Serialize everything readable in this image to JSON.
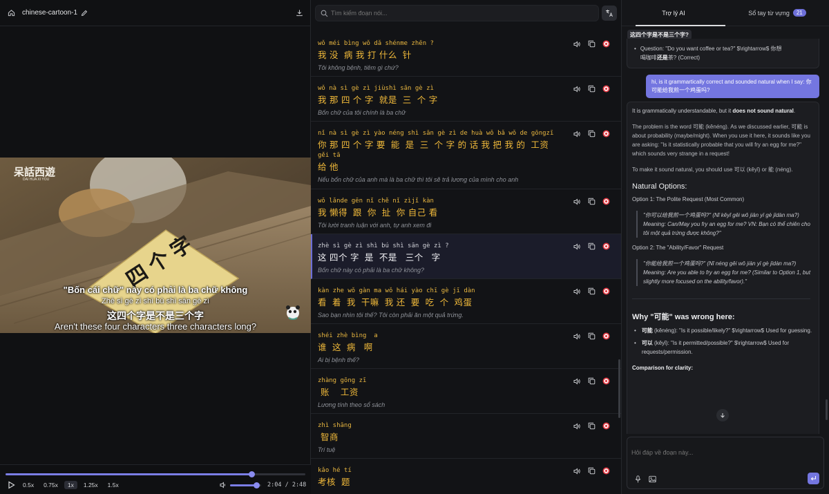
{
  "header": {
    "title": "chinese-cartoon-1"
  },
  "video": {
    "logo": "呆話西遊",
    "logo_sub": "DAI HUA XI YOU",
    "card_text": "四个字",
    "sub_vi": "\"Bốn cái chữ\" này có phải là ba chữ không",
    "sub_pinyin": "Zhè sì gè zì shì bù shì sān gè zì",
    "sub_zh": "这四个字是不是三个字",
    "sub_en": "Aren't these four characters three characters long?",
    "progress": 0.82
  },
  "player": {
    "speeds": [
      "0.5x",
      "0.75x",
      "1x",
      "1.25x",
      "1.5x"
    ],
    "active_speed": "1x",
    "time": "2:04 / 2:48",
    "volume": 0.85
  },
  "search": {
    "placeholder": "Tìm kiếm đoạn nói..."
  },
  "segments": [
    {
      "pinyin": "wǒ méi bìng wǒ dǎ shénme zhēn ?",
      "hanzi": "我 没  病 我 打 什么  针",
      "trans": "Tôi không bệnh, tiêm gì chứ?"
    },
    {
      "pinyin": "wǒ nà sì gè zì jiùshì sān gè zì",
      "hanzi": "我 那 四 个 字  就是  三  个 字",
      "trans": "Bốn chữ của tôi chính là ba chữ"
    },
    {
      "pinyin": "nǐ nà sì gè zì yào néng shì sān gè zì de huà wǒ bǎ wǒ de gōngzī",
      "hanzi": "你 那 四 个 字 要  能  是  三  个 字 的 话 我 把 我 的  工资",
      "pinyin2": "gěi tā",
      "hanzi2": "给 他",
      "trans": "Nếu bốn chữ của anh mà là ba chữ thì tôi sẽ trả lương của mình cho anh"
    },
    {
      "pinyin": "wǒ lǎnde gēn nǐ chě nǐ zìjǐ kàn",
      "hanzi": "我 懒得  跟  你  扯  你 自己 看",
      "trans": "Tôi lười tranh luận với anh, tự anh xem đi"
    },
    {
      "pinyin": "zhè sì gè zì shì bú shì sān gè zì ?",
      "hanzi": "这 四个 字  是  不是   三个   字",
      "trans": "Bốn chữ này có phải là ba chữ không?",
      "active": true
    },
    {
      "pinyin": "kàn zhe wǒ gàn ma wǒ hái yào chī gè jī dàn",
      "hanzi": "看  着  我  干嘛  我 还  要  吃  个  鸡蛋",
      "trans": "Sao bạn nhìn tôi thế? Tôi còn phải ăn một quả trứng."
    },
    {
      "pinyin": "shéi zhè bìng  a",
      "hanzi": "谁  这  病   啊",
      "trans": "Ai bị bệnh thế?"
    },
    {
      "pinyin": "zhàng gōng zī",
      "hanzi": " 账    工资",
      "trans": "Lương tính theo sổ sách"
    },
    {
      "pinyin": "zhì shāng",
      "hanzi": " 智商",
      "trans": "Trí tuệ"
    },
    {
      "pinyin": "kǎo hé tí",
      "hanzi": "考核  题",
      "trans": ""
    }
  ],
  "tabs": {
    "ai": "Trợ lý AI",
    "vocab": "Sổ tay từ vựng",
    "vocab_count": "21"
  },
  "chat": {
    "pinned": "这四个字是不是三个字?",
    "prev_q": "Question: \"Do you want coffee or tea?\" $\\rightarrow$ 你想",
    "prev_q2_pre": "喝咖啡",
    "prev_q2_bold": "还是",
    "prev_q2_post": "茶? (Correct)",
    "user_msg": "hi, is it grammartically correct and sounded natural when I say: 你可能给我煎一个鸡蛋吗?",
    "ai_p1_a": "It is grammatically understandable, but it ",
    "ai_p1_b": "does not sound natural",
    "ai_p1_c": ".",
    "ai_p2": "The problem is the word 可能 (kěnéng). As we discussed earlier, 可能 is about probability (maybe/might). When you use it here, it sounds like you are asking: \"Is it statistically probable that you will fry an egg for me?\" which sounds very strange in a request!",
    "ai_p3": "To make it sound natural, you should use 可以 (kěyǐ) or 能 (néng).",
    "h_natural": "Natural Options:",
    "opt1": "Option 1: The Polite Request (Most Common)",
    "opt1_q": "\"你可以给我煎一个鸡蛋吗?\" (Nǐ kěyǐ gěi wǒ jiān yī gè jīdàn ma?) Meaning: Can/May you fry an egg for me? VN: Bạn có thể chiên cho tôi một quả trứng được không?\"",
    "opt2": "Option 2: The \"Ability/Favor\" Request",
    "opt2_q": "\"你能给我煎一个鸡蛋吗?\" (Nǐ néng gěi wǒ jiān yī gè jīdàn ma?) Meaning: Are you able to fry an egg for me? (Similar to Option 1, but slightly more focused on the ability/favor).\"",
    "h_why": "Why \"可能\" was wrong here:",
    "why1_b": "可能",
    "why1": " (kěnéng): \"Is it possible/likely?\" $\\rightarrow$ Used for guessing.",
    "why2_b": "可以",
    "why2": " (kěyǐ): \"Is it permitted/possible?\" $\\rightarrow$ Used for requests/permission.",
    "compare": "Comparison for clarity:"
  },
  "chat_input": {
    "placeholder": "Hỏi đáp về đoạn này..."
  }
}
